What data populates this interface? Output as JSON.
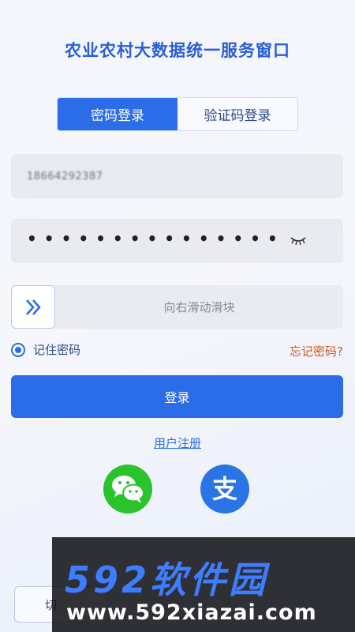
{
  "app": {
    "title": "农业农村大数据统一服务窗口"
  },
  "tabs": [
    {
      "label": "密码登录",
      "active": true
    },
    {
      "label": "验证码登录",
      "active": false
    }
  ],
  "form": {
    "phone_value": "18664292387",
    "password_masked": "•••••••••••••••",
    "slider_hint": "向右滑动滑块",
    "remember_label": "记住密码",
    "remember_checked": true,
    "forgot_label": "忘记密码?",
    "login_label": "登录",
    "register_label": "用户注册"
  },
  "social": [
    {
      "name": "wechat",
      "icon": "wechat-icon",
      "color": "#29c32c"
    },
    {
      "name": "alipay",
      "icon": "alipay-icon",
      "color": "#2a74e6"
    }
  ],
  "bottom": {
    "partial_button_label": "切"
  },
  "watermark": {
    "brand": "592软件园",
    "url": "www.592xiazai.com"
  },
  "colors": {
    "primary": "#2b6de8",
    "accent_orange": "#d2551e",
    "title_blue": "#2a5fd6"
  }
}
